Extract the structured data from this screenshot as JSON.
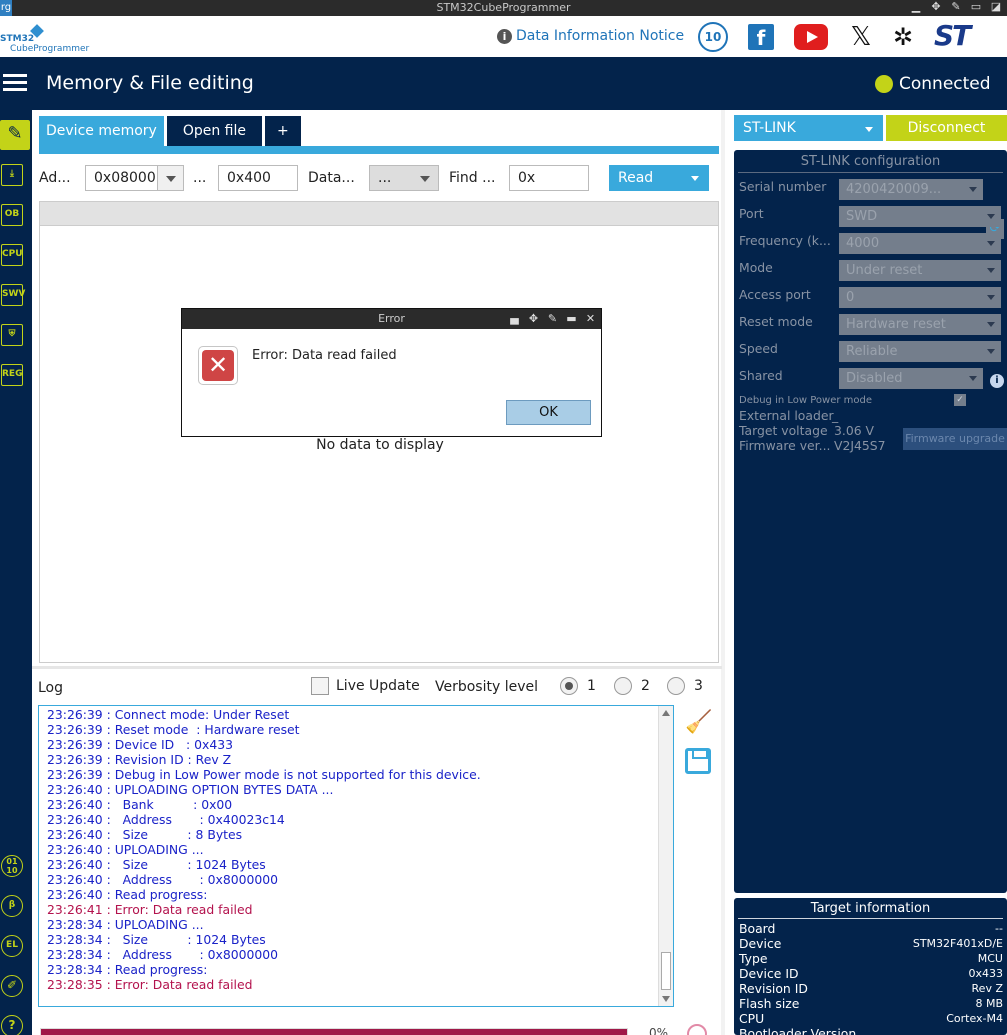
{
  "window": {
    "title": "STM32CubeProgrammer",
    "left_tag": "rg"
  },
  "header": {
    "logo_line1": "STM32",
    "logo_line2": "CubeProgrammer",
    "notice": "Data Information Notice",
    "anniversary": "10",
    "st_logo": "ST"
  },
  "nav": {
    "page_title": "Memory & File editing",
    "connection_status": "Connected",
    "status_color": "#c3d318"
  },
  "sidebar": {
    "items": [
      {
        "name": "memory-editing",
        "label": "✎"
      },
      {
        "name": "download",
        "label": "⤓"
      },
      {
        "name": "option-bytes",
        "label": "OB"
      },
      {
        "name": "cpu",
        "label": "CPU"
      },
      {
        "name": "swv",
        "label": "SWV"
      },
      {
        "name": "security",
        "label": "⛨"
      },
      {
        "name": "registers",
        "label": "REG"
      },
      {
        "name": "binary",
        "label": "01\n10"
      },
      {
        "name": "beta",
        "label": "β"
      },
      {
        "name": "elf",
        "label": "EL"
      },
      {
        "name": "tools",
        "label": "✐"
      },
      {
        "name": "help",
        "label": "?"
      }
    ]
  },
  "tabs": [
    {
      "label": "Device memory",
      "active": true
    },
    {
      "label": "Open file",
      "active": false
    },
    {
      "label": "+",
      "active": false
    }
  ],
  "toolbar": {
    "address_label": "Ad...",
    "address_value": "0x08000",
    "size_label": "...",
    "size_value": "0x400",
    "data_width_label": "Data...",
    "data_width_value": "...",
    "find_label": "Find ...",
    "find_value": "0x",
    "read_button": "Read"
  },
  "data_area": {
    "empty_message": "No data to display"
  },
  "log": {
    "title": "Log",
    "live_update": "Live Update",
    "verbosity_label": "Verbosity level",
    "verbosity_options": [
      "1",
      "2",
      "3"
    ],
    "verbosity_selected": "1",
    "lines": [
      {
        "text": "23:26:39 : Connect mode: Under Reset",
        "error": false
      },
      {
        "text": "23:26:39 : Reset mode  : Hardware reset",
        "error": false
      },
      {
        "text": "23:26:39 : Device ID   : 0x433",
        "error": false
      },
      {
        "text": "23:26:39 : Revision ID : Rev Z",
        "error": false
      },
      {
        "text": "23:26:39 : Debug in Low Power mode is not supported for this device.",
        "error": false
      },
      {
        "text": "23:26:40 : UPLOADING OPTION BYTES DATA ...",
        "error": false
      },
      {
        "text": "23:26:40 :   Bank          : 0x00",
        "error": false
      },
      {
        "text": "23:26:40 :   Address       : 0x40023c14",
        "error": false
      },
      {
        "text": "23:26:40 :   Size          : 8 Bytes",
        "error": false
      },
      {
        "text": "23:26:40 : UPLOADING ...",
        "error": false
      },
      {
        "text": "23:26:40 :   Size          : 1024 Bytes",
        "error": false
      },
      {
        "text": "23:26:40 :   Address       : 0x8000000",
        "error": false
      },
      {
        "text": "23:26:40 : Read progress:",
        "error": false
      },
      {
        "text": "23:26:41 : Error: Data read failed",
        "error": true
      },
      {
        "text": "23:28:34 : UPLOADING ...",
        "error": false
      },
      {
        "text": "23:28:34 :   Size          : 1024 Bytes",
        "error": false
      },
      {
        "text": "23:28:34 :   Address       : 0x8000000",
        "error": false
      },
      {
        "text": "23:28:34 : Read progress:",
        "error": false
      },
      {
        "text": "23:28:35 : Error: Data read failed",
        "error": true
      }
    ],
    "progress_percent": "0%"
  },
  "dialog": {
    "title": "Error",
    "message": "Error: Data read failed",
    "ok_button": "OK"
  },
  "right_panel": {
    "probe": "ST-LINK",
    "disconnect": "Disconnect",
    "config_title": "ST-LINK configuration",
    "fields": [
      {
        "label": "Serial number",
        "value": "4200420009..."
      },
      {
        "label": "Port",
        "value": "SWD"
      },
      {
        "label": "Frequency (k...",
        "value": "4000"
      },
      {
        "label": "Mode",
        "value": "Under reset"
      },
      {
        "label": "Access port",
        "value": "0"
      },
      {
        "label": "Reset mode",
        "value": "Hardware reset"
      },
      {
        "label": "Speed",
        "value": "Reliable"
      },
      {
        "label": "Shared",
        "value": "Disabled"
      }
    ],
    "debug_low_power": "Debug in Low Power mode",
    "external_loader": "External loader",
    "external_loader_value": "_",
    "target_voltage": "Target voltage",
    "target_voltage_value": "3.06 V",
    "firmware_version": "Firmware ver...",
    "firmware_version_value": "V2J45S7",
    "firmware_upgrade": "Firmware upgrade"
  },
  "target_info": {
    "title": "Target information",
    "rows": [
      {
        "label": "Board",
        "value": "--"
      },
      {
        "label": "Device",
        "value": "STM32F401xD/E"
      },
      {
        "label": "Type",
        "value": "MCU"
      },
      {
        "label": "Device ID",
        "value": "0x433"
      },
      {
        "label": "Revision ID",
        "value": "Rev Z"
      },
      {
        "label": "Flash size",
        "value": "8 MB"
      },
      {
        "label": "CPU",
        "value": "Cortex-M4"
      },
      {
        "label": "Bootloader Version",
        "value": ""
      }
    ]
  }
}
